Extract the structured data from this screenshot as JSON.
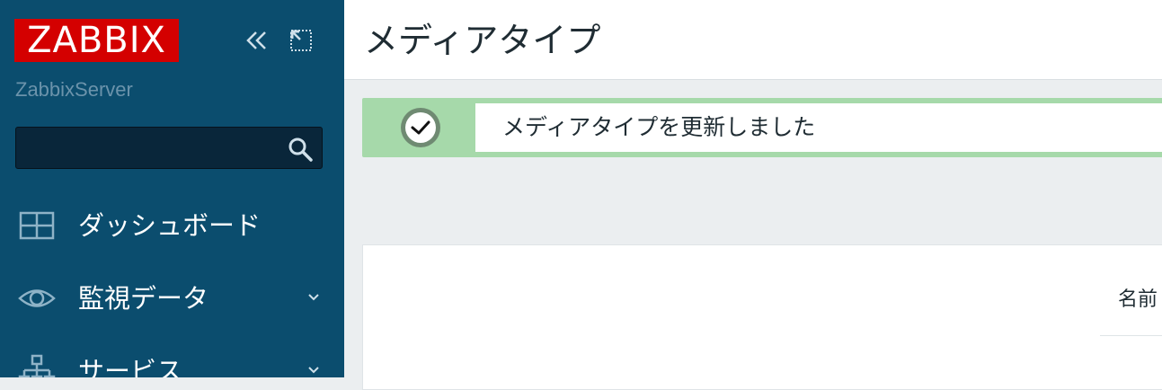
{
  "sidebar": {
    "logo_text": "ZABBIX",
    "server_name": "ZabbixServer",
    "search": {
      "value": "",
      "placeholder": ""
    },
    "items": [
      {
        "label": "ダッシュボード",
        "icon": "dashboard-icon"
      },
      {
        "label": "監視データ",
        "icon": "eye-icon",
        "expandable": true
      },
      {
        "label": "サービス",
        "icon": "services-icon",
        "expandable": true
      }
    ]
  },
  "header": {
    "title": "メディアタイプ"
  },
  "message": {
    "text": "メディアタイプを更新しました",
    "status": "success"
  },
  "form": {
    "name_label": "名前"
  },
  "colors": {
    "sidebar_bg": "#0b4d6e",
    "logo_bg": "#d40000",
    "success_bg": "#a6d9aa",
    "page_bg": "#ebeef0"
  }
}
